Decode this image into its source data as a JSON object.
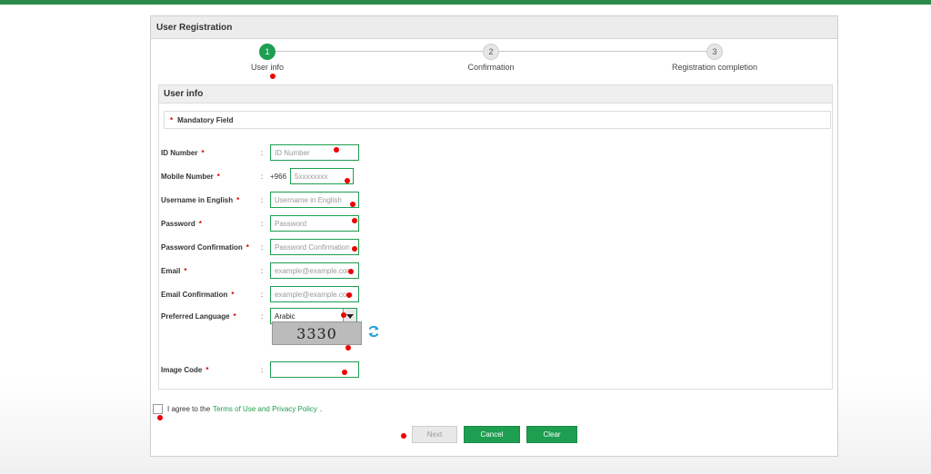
{
  "panel": {
    "title": "User Registration"
  },
  "steps": [
    {
      "number": "1",
      "label": "User info",
      "active": true
    },
    {
      "number": "2",
      "label": "Confirmation",
      "active": false
    },
    {
      "number": "3",
      "label": "Registration completion",
      "active": false
    }
  ],
  "section": {
    "title": "User info",
    "mandatory_note": "Mandatory Field"
  },
  "form": {
    "id_number": {
      "label": "ID Number",
      "placeholder": "ID Number"
    },
    "mobile": {
      "label": "Mobile Number",
      "prefix": "+966",
      "placeholder": "5xxxxxxxx"
    },
    "username": {
      "label": "Username in English",
      "placeholder": "Username in English"
    },
    "password": {
      "label": "Password",
      "placeholder": "Password"
    },
    "password_confirm": {
      "label": "Password Confirmation",
      "placeholder": "Password Confirmation"
    },
    "email": {
      "label": "Email",
      "placeholder": "example@example.com"
    },
    "email_confirm": {
      "label": "Email Confirmation",
      "placeholder": "example@example.com"
    },
    "language": {
      "label": "Preferred Language",
      "value": "Arabic"
    },
    "captcha_text": "3330",
    "image_code": {
      "label": "Image Code",
      "value": ""
    }
  },
  "agreement": {
    "prefix": "I agree to the",
    "link": "Terms of Use and Privacy Policy",
    "suffix": "."
  },
  "buttons": {
    "next": "Next",
    "cancel": "Cancel",
    "clear": "Clear"
  },
  "colors": {
    "accent": "#1e9e50",
    "required": "#dd0000",
    "marker": "#ee0000"
  }
}
